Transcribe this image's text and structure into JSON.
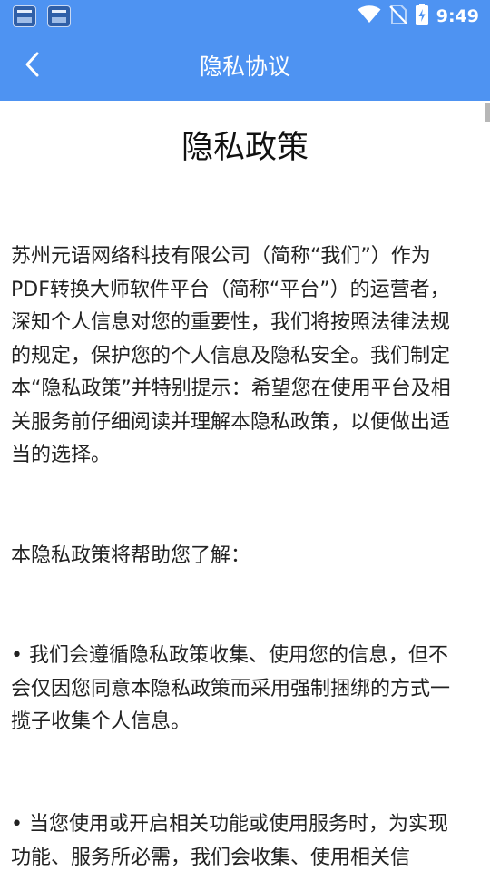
{
  "status_bar": {
    "time": "9:49",
    "icons": [
      "app-icon",
      "app-icon",
      "wifi-icon",
      "no-sim-icon",
      "battery-charging-icon"
    ]
  },
  "header": {
    "title": "隐私协议",
    "back_icon": "chevron-left-icon",
    "background_color": "#4e93f2"
  },
  "document": {
    "title": "隐私政策",
    "paragraphs": [
      "苏州元语网络科技有限公司（简称“我们”）作为PDF转换大师软件平台（简称“平台”）的运营者，深知个人信息对您的重要性，我们将按照法律法规的规定，保护您的个人信息及隐私安全。我们制定本“隐私政策”并特别提示：希望您在使用平台及相关服务前仔细阅读并理解本隐私政策，以便做出适当的选择。",
      "本隐私政策将帮助您了解：",
      "• 我们会遵循隐私政策收集、使用您的信息，但不会仅因您同意本隐私政策而采用强制捆绑的方式一揽子收集个人信息。",
      "• 当您使用或开启相关功能或使用服务时，为实现功能、服务所必需，我们会收集、使用相关信"
    ]
  }
}
